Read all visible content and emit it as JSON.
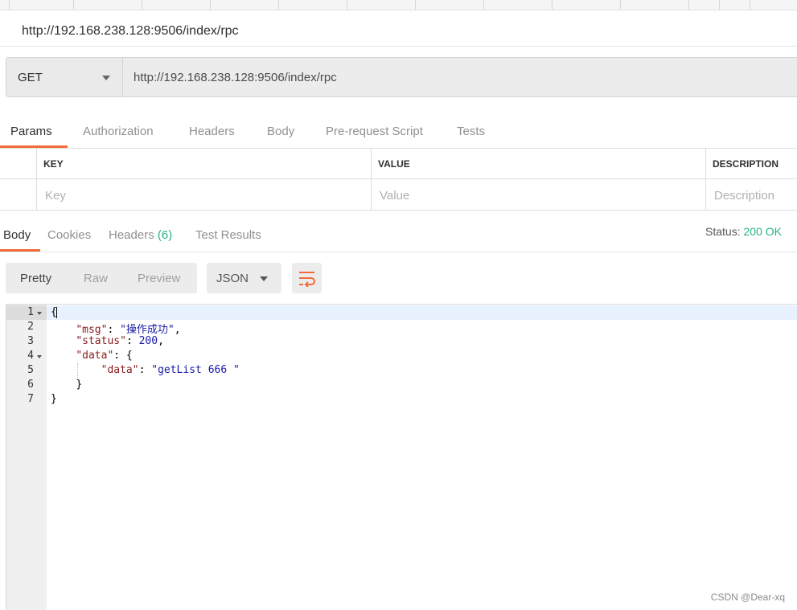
{
  "request": {
    "title": "http://192.168.238.128:9506/index/rpc",
    "method": "GET",
    "url": "http://192.168.238.128:9506/index/rpc"
  },
  "request_tabs": [
    {
      "label": "Params"
    },
    {
      "label": "Authorization"
    },
    {
      "label": "Headers"
    },
    {
      "label": "Body"
    },
    {
      "label": "Pre-request Script"
    },
    {
      "label": "Tests"
    }
  ],
  "params": {
    "headers": {
      "key": "KEY",
      "value": "VALUE",
      "description": "DESCRIPTION"
    },
    "placeholders": {
      "key": "Key",
      "value": "Value",
      "description": "Description"
    }
  },
  "response_tabs": {
    "body": "Body",
    "cookies": "Cookies",
    "headers": "Headers",
    "headers_count": "(6)",
    "test_results": "Test Results"
  },
  "status": {
    "label": "Status:",
    "value": "200 OK"
  },
  "view_options": {
    "pretty": "Pretty",
    "raw": "Raw",
    "preview": "Preview",
    "language": "JSON"
  },
  "editor": {
    "line_numbers": [
      "1",
      "2",
      "3",
      "4",
      "5",
      "6",
      "7"
    ],
    "lines": {
      "l1_open": "{",
      "l2_key": "\"msg\"",
      "l2_sep": ": ",
      "l2_value": "\"操作成功\"",
      "l2_end": ",",
      "l3_key": "\"status\"",
      "l3_sep": ": ",
      "l3_value": "200",
      "l3_end": ",",
      "l4_key": "\"data\"",
      "l4_sep": ": {",
      "l5_key": "\"data\"",
      "l5_sep": ": ",
      "l5_value": "\"getList 666 \"",
      "l6_close": "}",
      "l7_close": "}"
    }
  },
  "watermark": "CSDN @Dear-xq"
}
